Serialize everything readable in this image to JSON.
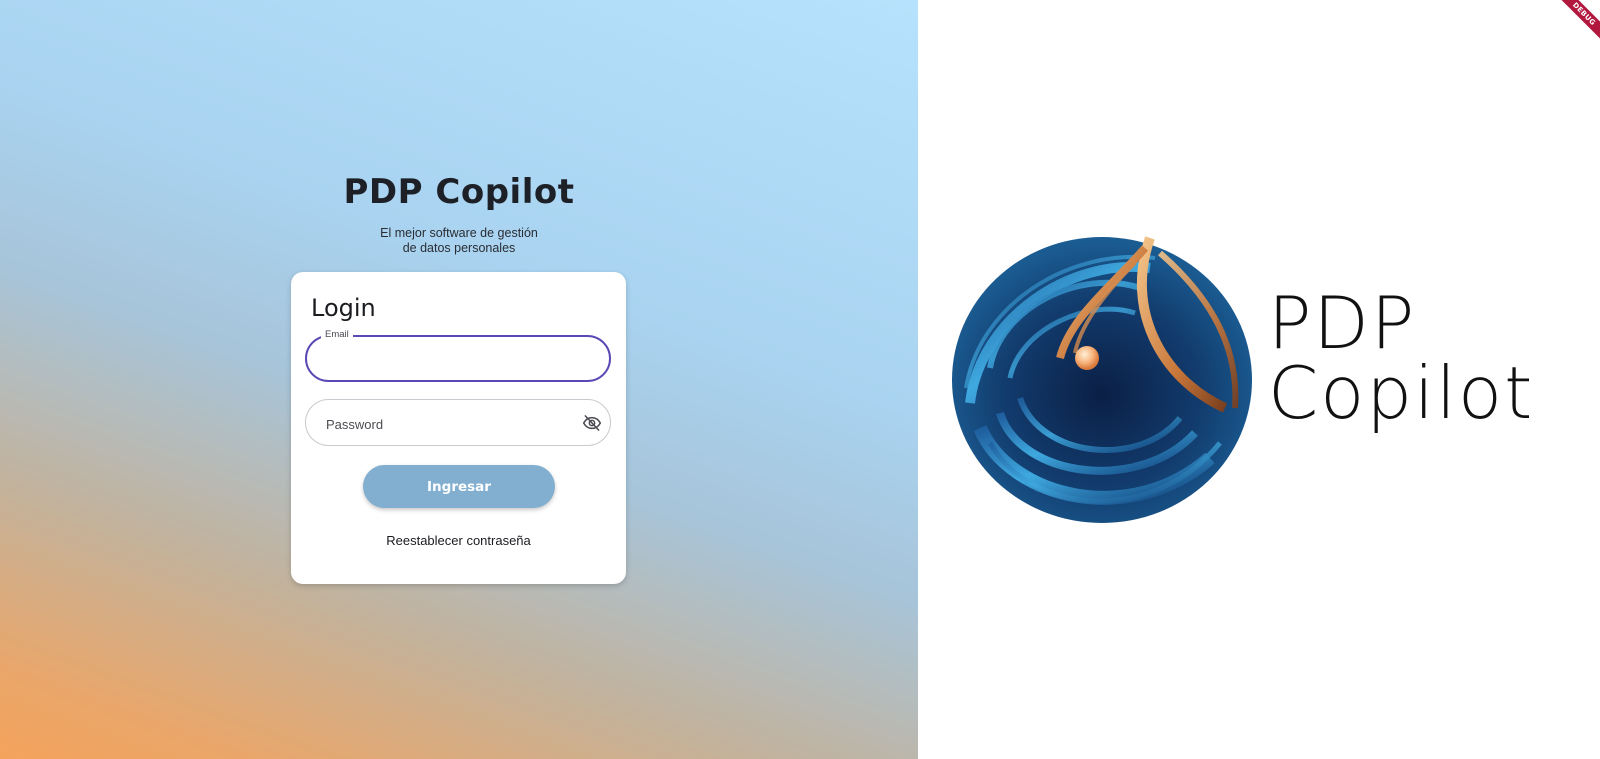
{
  "app": {
    "title": "PDP Copilot",
    "tagline_line1": "El mejor software de gestión",
    "tagline_line2": "de datos personales"
  },
  "login_card": {
    "title": "Login",
    "email": {
      "label": "Email",
      "value": ""
    },
    "password": {
      "placeholder": "Password",
      "value": "",
      "visibility_icon": "eye-off-icon"
    },
    "submit_label": "Ingresar",
    "reset_link_label": "Reestablecer contraseña"
  },
  "logo": {
    "line1": "PDP",
    "line2": "Copilot"
  },
  "debug_banner": "DEBUG",
  "colors": {
    "focus_border": "#5b48b5",
    "button": "#82aed0",
    "gradient_top": "#b6e2fd",
    "gradient_bottom": "#f4a35c",
    "debug_ribbon": "#b2173e"
  }
}
